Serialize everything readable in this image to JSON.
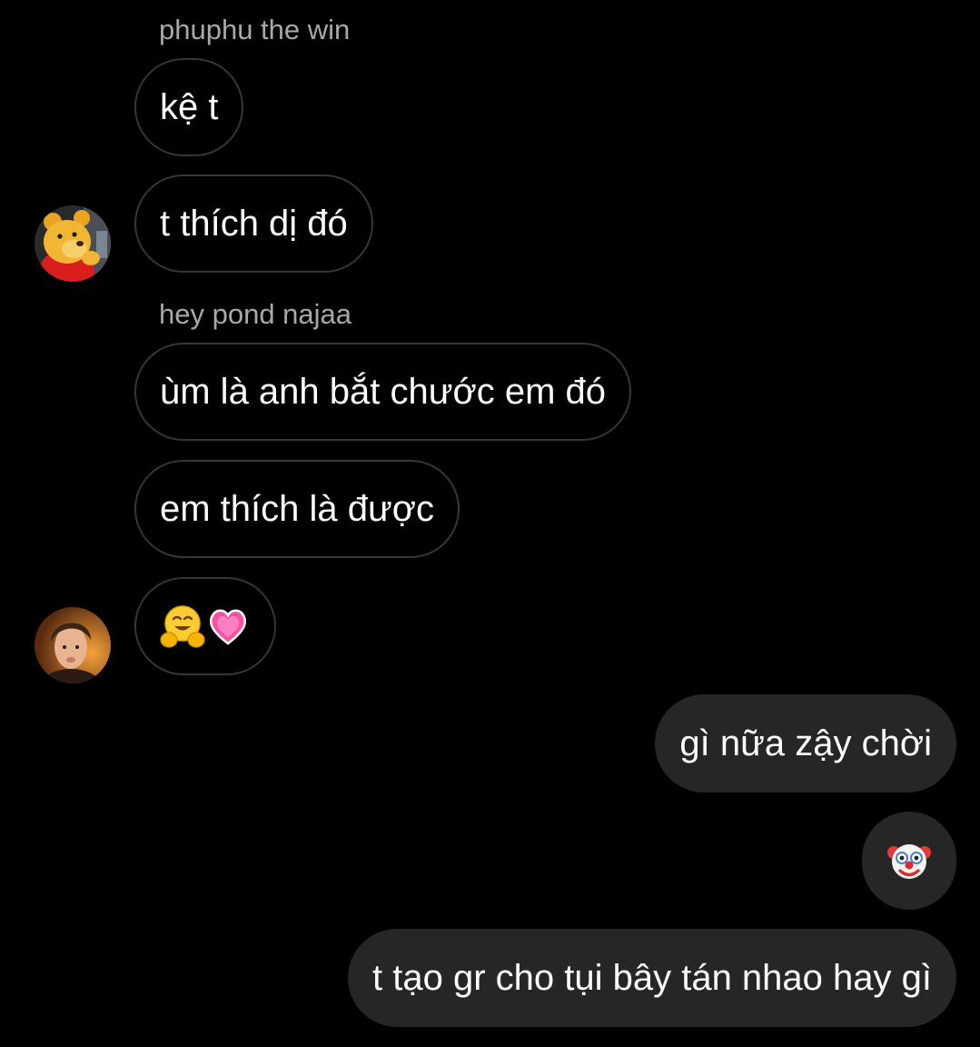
{
  "conversation": {
    "sender_1": "phuphu the win",
    "sender_2": "hey pond najaa",
    "messages": [
      {
        "text": "kệ t"
      },
      {
        "text": "t thích dị đó"
      },
      {
        "text": "ùm là anh bắt chước em đó"
      },
      {
        "text": "em thích là được"
      },
      {
        "emoji": [
          "hugging-face",
          "growing-heart"
        ]
      },
      {
        "text": "gì nữa zậy chời"
      },
      {
        "emoji": [
          "clown-face"
        ]
      },
      {
        "text": "t tạo gr cho tụi bây tán nhao hay gì"
      }
    ],
    "avatars": {
      "sender_1": "winnie-the-pooh-avatar",
      "sender_2": "person-photo-avatar"
    }
  },
  "colors": {
    "background": "#000000",
    "incoming_border": "#363636",
    "outgoing_fill": "#262626",
    "sender_name": "#a8a8a8",
    "text": "#ffffff"
  }
}
